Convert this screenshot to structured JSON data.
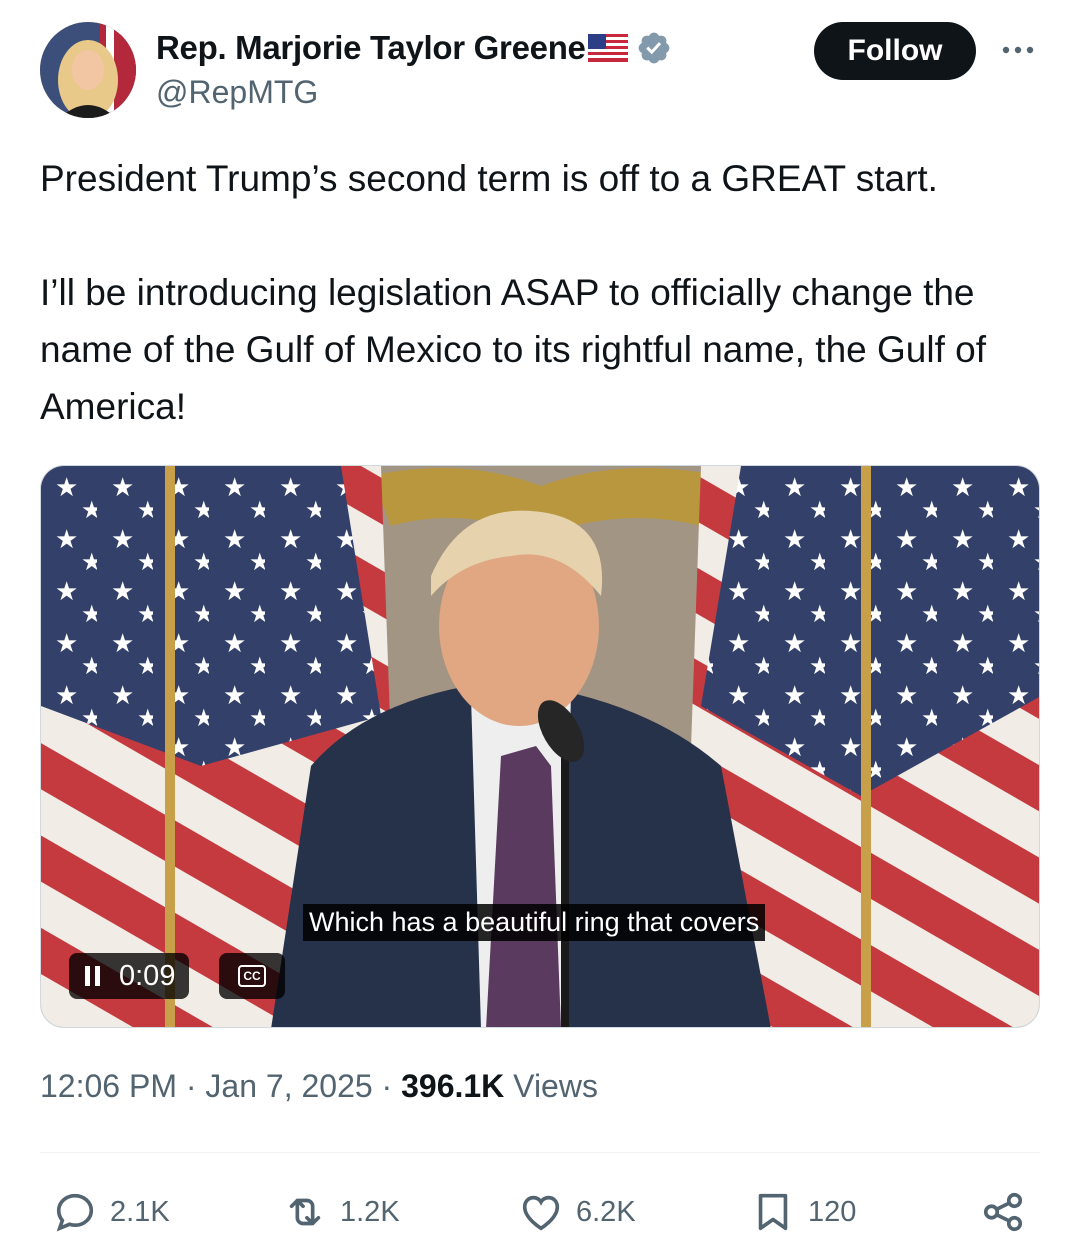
{
  "author": {
    "display_name": "Rep. Marjorie Taylor Greene",
    "handle": "@RepMTG"
  },
  "follow_label": "Follow",
  "tweet": {
    "line1": "President Trump’s second term is off to a GREAT start.",
    "line2": "I’ll be introducing legislation ASAP to officially change the name of the Gulf of Mexico to its rightful name, the Gulf of America!"
  },
  "video": {
    "caption": "Which has a beautiful ring that covers",
    "timecode": "0:09",
    "cc_label": "CC"
  },
  "meta": {
    "time": "12:06 PM",
    "date": "Jan 7, 2025",
    "separator": "·",
    "views_count": "396.1K",
    "views_label": "Views"
  },
  "actions": {
    "replies": "2.1K",
    "reposts": "1.2K",
    "likes": "6.2K",
    "bookmarks": "120"
  },
  "colors": {
    "text_primary": "#0f1419",
    "text_secondary": "#536471",
    "verified": "#829aab",
    "follow_bg": "#0f1419"
  }
}
